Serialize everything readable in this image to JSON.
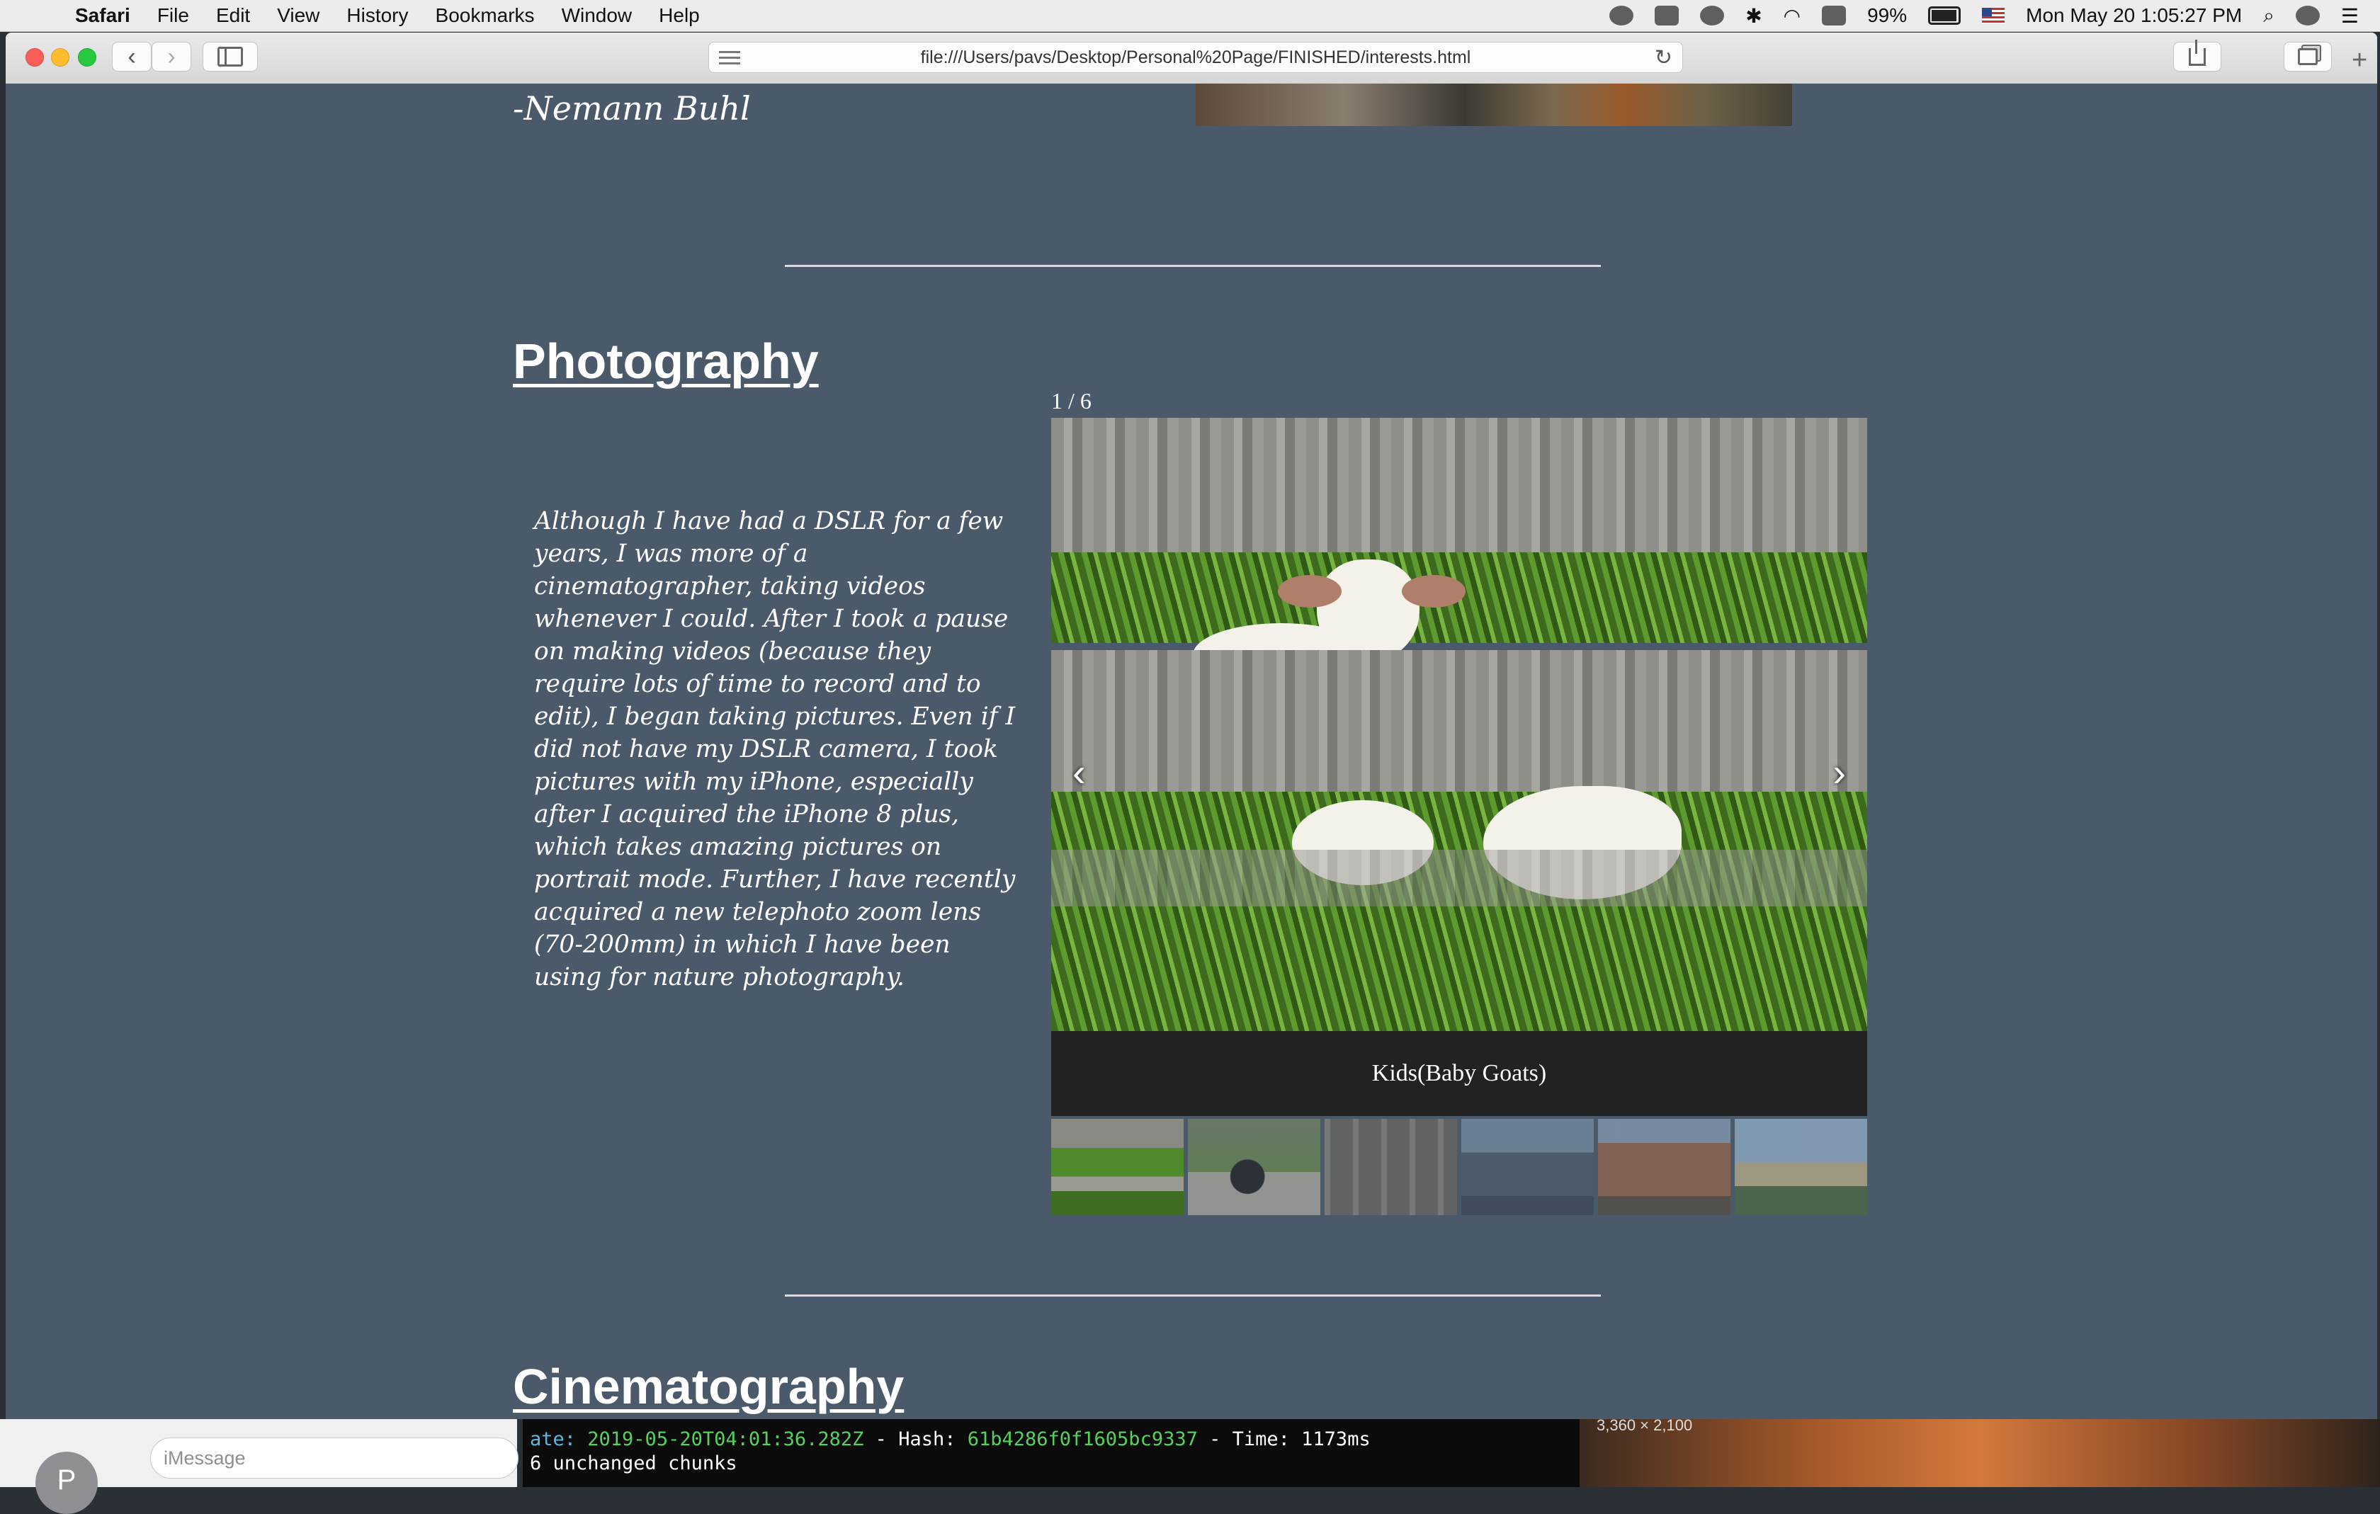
{
  "menubar": {
    "apple_symbol": "",
    "app_name": "Safari",
    "items": [
      "File",
      "Edit",
      "View",
      "History",
      "Bookmarks",
      "Window",
      "Help"
    ],
    "battery_percent": "99%",
    "datetime": "Mon May 20  1:05:27 PM"
  },
  "browser": {
    "url": "file:///Users/pavs/Desktop/Personal%20Page/FINISHED/interests.html",
    "back_glyph": "‹",
    "forward_glyph": "›",
    "reload_glyph": "↻",
    "new_tab_glyph": "+"
  },
  "page": {
    "quote_author": "-Nemann Buhl",
    "photography": {
      "heading": "Photography",
      "paragraph": "Although I have had a DSLR for a few years, I was more of a cinematographer, taking videos whenever I could. After I took a pause on making videos (because they require lots of time to record and to edit), I began taking pictures. Even if I did not have my DSLR camera, I took pictures with my iPhone, especially after I acquired the iPhone 8 plus, which takes amazing pictures on portrait mode. Further, I have recently acquired a new telephoto zoom lens (70-200mm) in which I have been using for nature photography.",
      "slideshow": {
        "counter": "1 / 6",
        "prev_glyph": "‹",
        "next_glyph": "›",
        "caption": "Kids(Baby Goats)",
        "thumbnail_count": 6,
        "active_index": 0
      }
    },
    "cinematography": {
      "heading": "Cinematography"
    }
  },
  "background_apps": {
    "messages": {
      "placeholder": "iMessage",
      "avatar_initial": "P"
    },
    "terminal": {
      "line1_prefix": "ate: ",
      "line1_date": "2019-05-20T04:01:36.282Z",
      "line1_hash_label": " - Hash: ",
      "line1_hash": "61b4286f0f1605bc9337",
      "line1_time_label": " - Time: ",
      "line1_time": "1173",
      "line1_unit": "ms",
      "line2": "6 unchanged chunks"
    },
    "desktop_image_dims": "3,360 × 2,100"
  }
}
